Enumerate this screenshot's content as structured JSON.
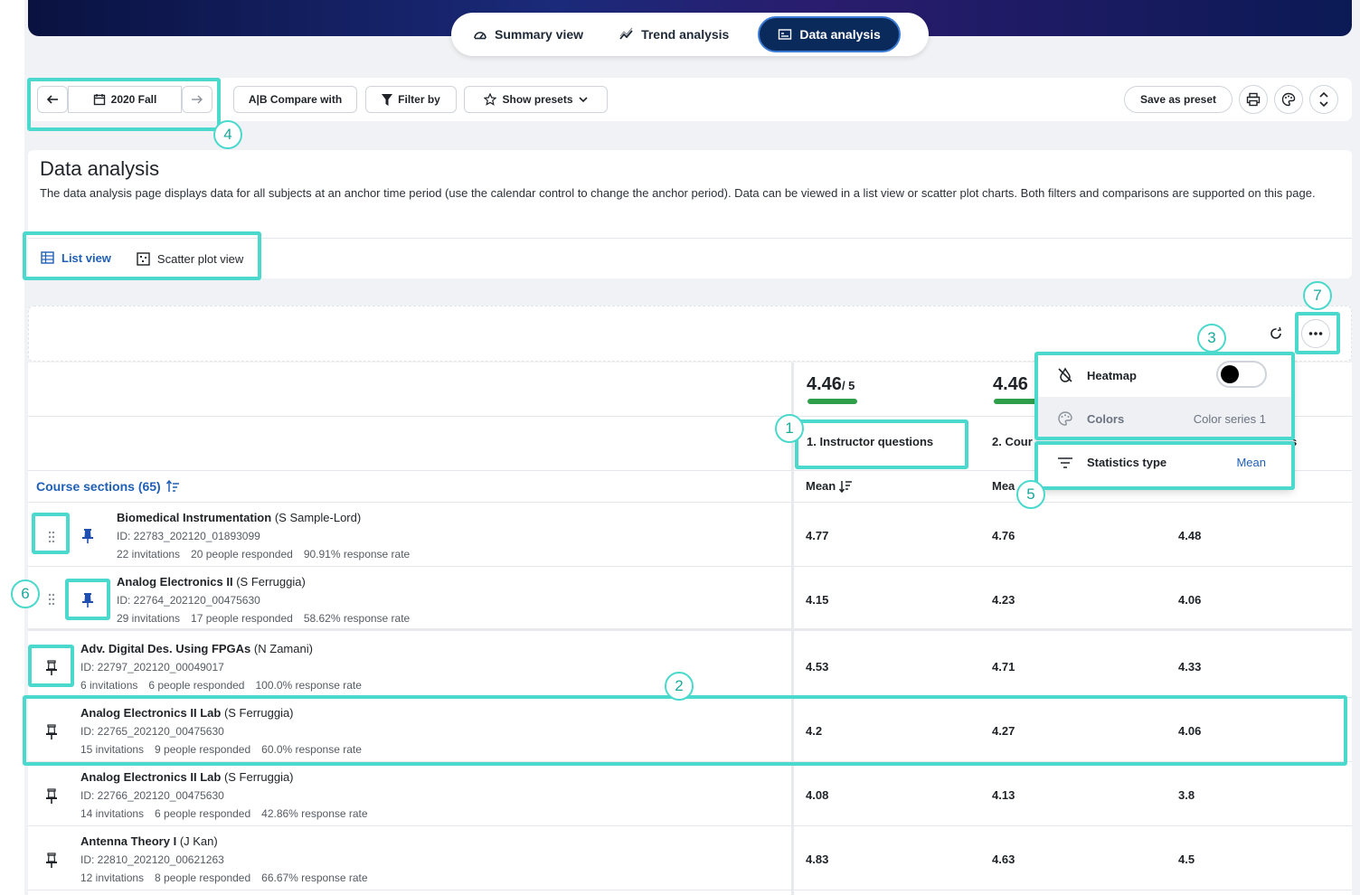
{
  "tabs": [
    {
      "label": "Summary view",
      "icon": "gauge-icon",
      "active": false
    },
    {
      "label": "Trend analysis",
      "icon": "trend-icon",
      "active": false
    },
    {
      "label": "Data analysis",
      "icon": "data-table-icon",
      "active": true
    }
  ],
  "toolbar": {
    "period": "2020 Fall",
    "compare_label": "A|B Compare with",
    "filter_label": "Filter by",
    "presets_label": "Show presets",
    "save_preset_label": "Save as preset"
  },
  "page": {
    "title": "Data analysis",
    "description": "The data analysis page displays data for all subjects at an anchor time period (use the calendar control to change the anchor period). Data can be viewed in a list view or scatter plot charts. Both filters and comparisons are supported on this page."
  },
  "view_tabs": {
    "list": "List view",
    "scatter": "Scatter plot view"
  },
  "table": {
    "sections_label": "Course sections (65)",
    "columns": [
      {
        "score": "4.46",
        "out_of": "/ 5",
        "title": "1. Instructor questions",
        "stat": "Mean"
      },
      {
        "score": "4.46",
        "title": "2. Cour",
        "stat": "Mea"
      },
      {
        "title": "s"
      }
    ],
    "rows": [
      {
        "title": "Biomedical Instrumentation",
        "instructor": "(S Sample-Lord)",
        "id": "ID: 22783_202120_01893099",
        "invitations": "22 invitations",
        "responded": "20 people responded",
        "rate": "90.91% response rate",
        "values": [
          "4.77",
          "4.76",
          "4.48"
        ]
      },
      {
        "title": "Analog Electronics II",
        "instructor": "(S Ferruggia)",
        "id": "ID: 22764_202120_00475630",
        "invitations": "29 invitations",
        "responded": "17 people responded",
        "rate": "58.62% response rate",
        "values": [
          "4.15",
          "4.23",
          "4.06"
        ]
      },
      {
        "title": "Adv. Digital Des. Using FPGAs",
        "instructor": "(N Zamani)",
        "id": "ID: 22797_202120_00049017",
        "invitations": "6 invitations",
        "responded": "6 people responded",
        "rate": "100.0% response rate",
        "values": [
          "4.53",
          "4.71",
          "4.33"
        ]
      },
      {
        "title": "Analog Electronics II Lab",
        "instructor": "(S Ferruggia)",
        "id": "ID: 22765_202120_00475630",
        "invitations": "15 invitations",
        "responded": "9 people responded",
        "rate": "60.0% response rate",
        "values": [
          "4.2",
          "4.27",
          "4.06"
        ]
      },
      {
        "title": "Analog Electronics II Lab",
        "instructor": "(S Ferruggia)",
        "id": "ID: 22766_202120_00475630",
        "invitations": "14 invitations",
        "responded": "6 people responded",
        "rate": "42.86% response rate",
        "values": [
          "4.08",
          "4.13",
          "3.8"
        ]
      },
      {
        "title": "Antenna Theory I",
        "instructor": "(J Kan)",
        "id": "ID: 22810_202120_00621263",
        "invitations": "12 invitations",
        "responded": "8 people responded",
        "rate": "66.67% response rate",
        "values": [
          "4.83",
          "4.63",
          "4.5"
        ]
      }
    ]
  },
  "menu": {
    "heatmap": "Heatmap",
    "colors": "Colors",
    "colors_value": "Color series 1",
    "stat_type": "Statistics type",
    "stat_value": "Mean"
  },
  "badges": [
    "1",
    "2",
    "3",
    "4",
    "5",
    "6",
    "7"
  ],
  "colors": {
    "highlight": "#4ad9cc",
    "accent": "#1f5fb5",
    "active_tab": "#0b2a5c",
    "score_bar": "#2e9e4a"
  }
}
